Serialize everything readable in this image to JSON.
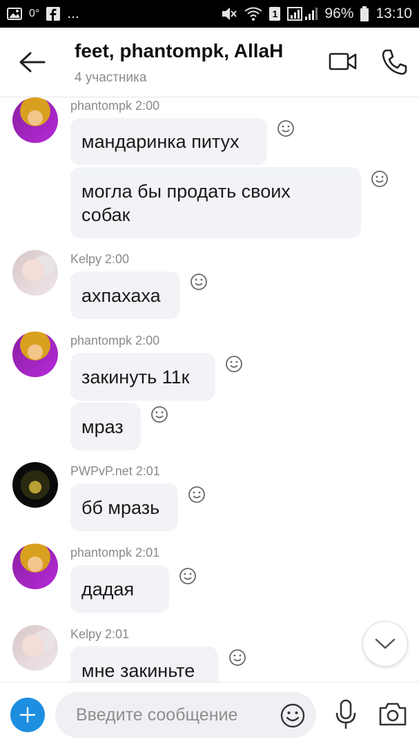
{
  "status_bar": {
    "temp": "0°",
    "more": "...",
    "sim_number": "1",
    "battery": "96%",
    "time": "13:10"
  },
  "header": {
    "title": "feet, phantompk, AllaH",
    "subtitle": "4 участника"
  },
  "messages": [
    {
      "sender": "phantompk",
      "time": "2:00",
      "text": "мандаринка питух"
    },
    {
      "sender": "phantompk",
      "time": "2:00",
      "text": "могла бы продать своих собак"
    },
    {
      "sender": "Kelpy",
      "time": "2:00",
      "text": "ахпахаха"
    },
    {
      "sender": "phantompk",
      "time": "2:00",
      "text": "закинуть 11к"
    },
    {
      "sender": "phantompk",
      "time": "2:00",
      "text": "мраз"
    },
    {
      "sender": "PWPvP.net",
      "time": "2:01",
      "text": "бб мразь"
    },
    {
      "sender": "phantompk",
      "time": "2:01",
      "text": "дадая"
    },
    {
      "sender": "Kelpy",
      "time": "2:01",
      "text": "мне закиньте"
    }
  ],
  "sender_lines": {
    "g0": "phantompk 2:00",
    "g1": "Kelpy 2:00",
    "g2": "phantompk 2:00",
    "g3": "PWPvP.net 2:01",
    "g4": "phantompk 2:01",
    "g5": "Kelpy 2:01"
  },
  "input": {
    "placeholder": "Введите сообщение"
  },
  "colors": {
    "accent": "#1e8fe0",
    "bubble_bg": "#f1f3f6",
    "status_bar_bg": "#000000"
  },
  "icons": [
    "image-icon",
    "facebook-icon",
    "mute-icon",
    "wifi-icon",
    "signal-icon",
    "battery-icon",
    "back-arrow-icon",
    "video-call-icon",
    "phone-icon",
    "smiley-react-icon",
    "chevron-down-icon",
    "plus-icon",
    "emoji-icon",
    "mic-icon",
    "camera-icon"
  ]
}
